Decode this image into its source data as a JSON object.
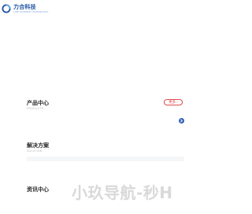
{
  "header": {
    "logo_cn": "力合科技",
    "logo_en": "LIHE SCIENCE TECHNOLOGY",
    "logo_icon": "brand-logo-icon"
  },
  "products": {
    "title": "产品中心",
    "subtitle": "PRODUCTS",
    "more_label": "更多",
    "more_icon": "chevron-right-icon",
    "nav_dot_icon": "arrow-right-icon"
  },
  "solutions": {
    "title": "解决方案",
    "subtitle": "SOLUTION"
  },
  "news": {
    "title": "资讯中心"
  },
  "watermark": {
    "text": "小玖导航-秒H"
  },
  "colors": {
    "brand_blue": "#1b4fa3",
    "accent_red": "#e24b4b",
    "dot_blue": "#2f5fb5"
  }
}
